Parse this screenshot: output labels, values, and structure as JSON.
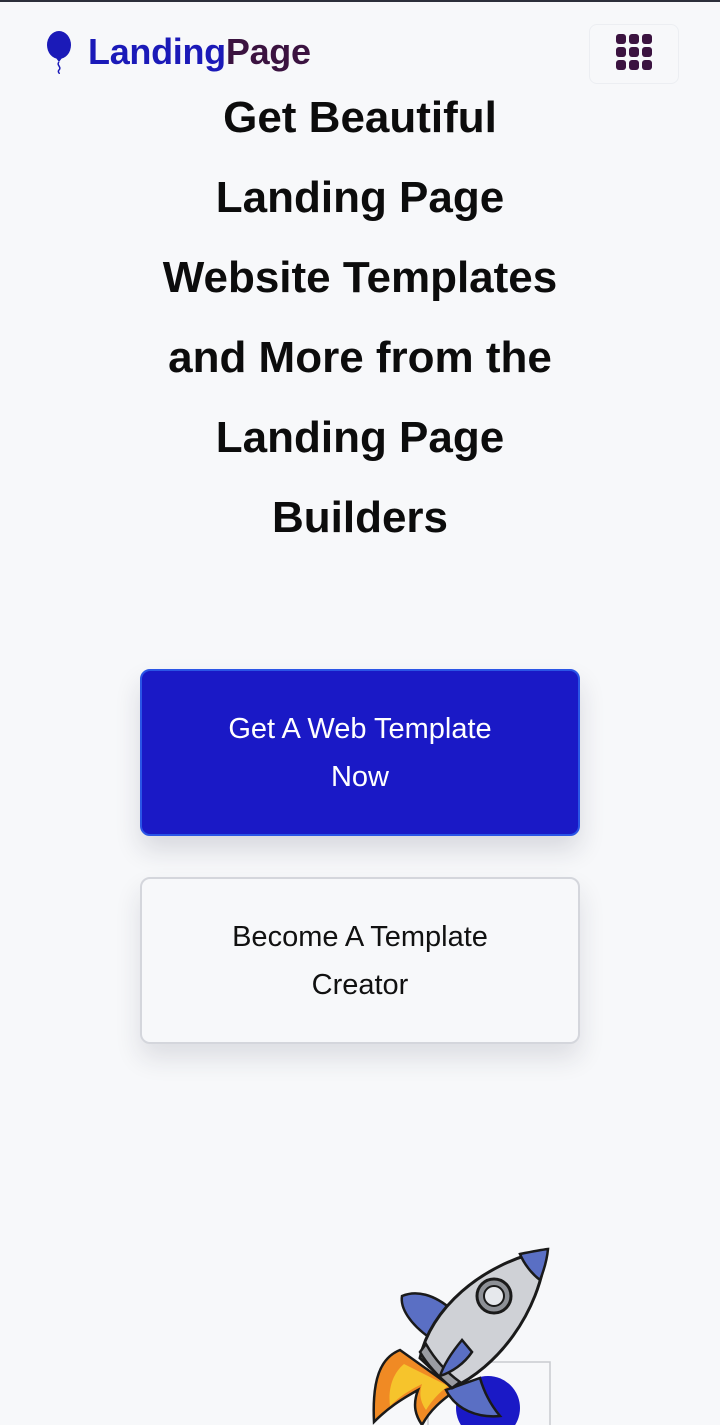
{
  "header": {
    "brand_part1": "Landing",
    "brand_part2": "Page"
  },
  "hero": {
    "title_lines": [
      "Get Beautiful",
      "Landing Page",
      "Website Templates",
      "and More from the",
      "Landing Page",
      "Builders"
    ],
    "primary_button": "Get A Web Template Now",
    "secondary_button": "Become A Template Creator"
  },
  "icons": {
    "logo": "balloon-icon",
    "menu": "grid-menu-icon",
    "illustration": "rocket-illustration"
  },
  "colors": {
    "brand_blue": "#1b1ab8",
    "brand_purple": "#3b1340",
    "primary_button": "#1a19c6",
    "background": "#f7f8fa"
  }
}
